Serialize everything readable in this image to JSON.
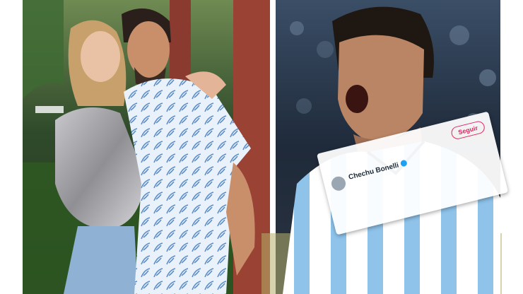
{
  "tweet": {
    "author": "Chechu Bonelli",
    "follow_label": "Seguir"
  },
  "colors": {
    "left_photo_background": "#2f4a2a",
    "right_photo_background": "#1f2a3a",
    "jersey_light_blue": "#8fc3ea",
    "mention_pink": "#e0245e"
  },
  "icons": [
    "verified-badge-icon"
  ]
}
